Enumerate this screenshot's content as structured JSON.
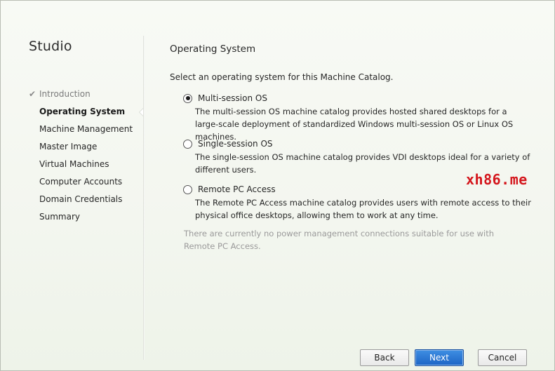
{
  "app": {
    "title": "Studio"
  },
  "steps": [
    {
      "label": "Introduction",
      "state": "done"
    },
    {
      "label": "Operating System",
      "state": "active"
    },
    {
      "label": "Machine Management",
      "state": "pending"
    },
    {
      "label": "Master Image",
      "state": "pending"
    },
    {
      "label": "Virtual Machines",
      "state": "pending"
    },
    {
      "label": "Computer Accounts",
      "state": "pending"
    },
    {
      "label": "Domain Credentials",
      "state": "pending"
    },
    {
      "label": "Summary",
      "state": "pending"
    }
  ],
  "page": {
    "title": "Operating System",
    "instruction": "Select an operating system for this Machine Catalog.",
    "options": [
      {
        "label": "Multi-session OS",
        "description": "The multi-session OS machine catalog provides hosted shared desktops for a large-scale deployment of standardized Windows multi-session OS or Linux OS machines.",
        "selected": true
      },
      {
        "label": "Single-session OS",
        "description": "The single-session OS machine catalog provides VDI desktops ideal for a variety of different users.",
        "selected": false
      },
      {
        "label": "Remote PC Access",
        "description": "The Remote PC Access machine catalog provides users with remote access to their physical office desktops, allowing them to work at any time.",
        "selected": false
      }
    ],
    "note": "There are currently no power management connections suitable for use with Remote PC Access."
  },
  "buttons": {
    "back": "Back",
    "next": "Next",
    "cancel": "Cancel"
  },
  "watermark": {
    "text": "xh86.me",
    "color": "#d4161c"
  },
  "colors": {
    "primary_button": "#1c64c5",
    "disabled_text": "#9a9a9a"
  }
}
